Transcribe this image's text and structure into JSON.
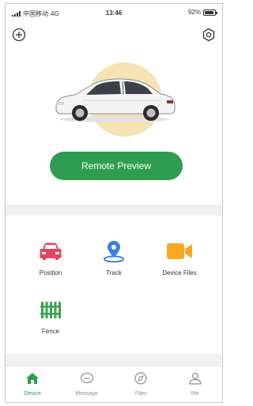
{
  "status_bar": {
    "carrier": "中国移动",
    "network": "4G",
    "time": "13:46",
    "battery_text": "92%",
    "battery_level": 0.92
  },
  "header": {
    "add_icon": "plus-circle-icon",
    "settings_icon": "gear-icon"
  },
  "hero": {
    "image": "car-illustration",
    "accent_color": "#f7e2b4"
  },
  "remote_preview": {
    "label": "Remote Preview",
    "color": "#2e9d4f"
  },
  "features": [
    {
      "label": "Position",
      "icon": "car-icon",
      "color": "#e0475f"
    },
    {
      "label": "Track",
      "icon": "map-pin-icon",
      "color": "#3d7fe0"
    },
    {
      "label": "Device Files",
      "icon": "video-camera-icon",
      "color": "#f6a821"
    },
    {
      "label": "Fence",
      "icon": "fence-icon",
      "color": "#3aa34f"
    }
  ],
  "tabs": [
    {
      "label": "Device",
      "icon": "home-icon",
      "active": true
    },
    {
      "label": "Message",
      "icon": "message-icon",
      "active": false
    },
    {
      "label": "Files",
      "icon": "compass-icon",
      "active": false
    },
    {
      "label": "Me",
      "icon": "user-icon",
      "active": false
    }
  ],
  "colors": {
    "brand_green": "#2e9d4f",
    "separator": "#f1f1f1"
  }
}
